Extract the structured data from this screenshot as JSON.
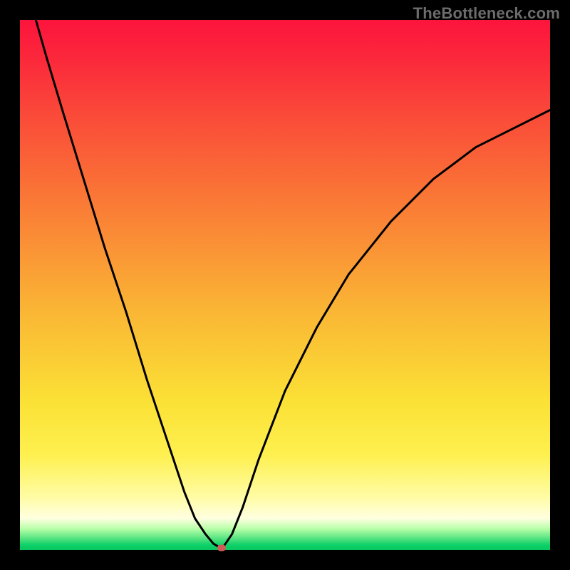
{
  "watermark": "TheBottleneck.com",
  "colors": {
    "frame": "#000000",
    "curve": "#000000",
    "marker": "#cf5b57"
  },
  "chart_data": {
    "type": "line",
    "title": "",
    "xlabel": "",
    "ylabel": "",
    "xlim": [
      0,
      100
    ],
    "ylim": [
      0,
      100
    ],
    "grid": false,
    "series": [
      {
        "name": "bottleneck-curve",
        "x": [
          3,
          5,
          8,
          12,
          16,
          20,
          24,
          28,
          31,
          33,
          35,
          36.5,
          37.5,
          38,
          38.5,
          40,
          42,
          45,
          50,
          56,
          62,
          70,
          78,
          86,
          94,
          100
        ],
        "y": [
          100,
          93,
          83,
          70,
          57,
          45,
          32,
          20,
          11,
          6,
          3,
          1.2,
          0.6,
          0.4,
          0.8,
          3,
          8,
          17,
          30,
          42,
          52,
          62,
          70,
          76,
          80,
          83
        ]
      }
    ],
    "marker": {
      "x": 38,
      "y": 0.4
    },
    "background_gradient": {
      "top": "#fc143c",
      "mid": "#fab635",
      "near_bottom": "#ffffe0",
      "bottom": "#07c75f"
    }
  }
}
